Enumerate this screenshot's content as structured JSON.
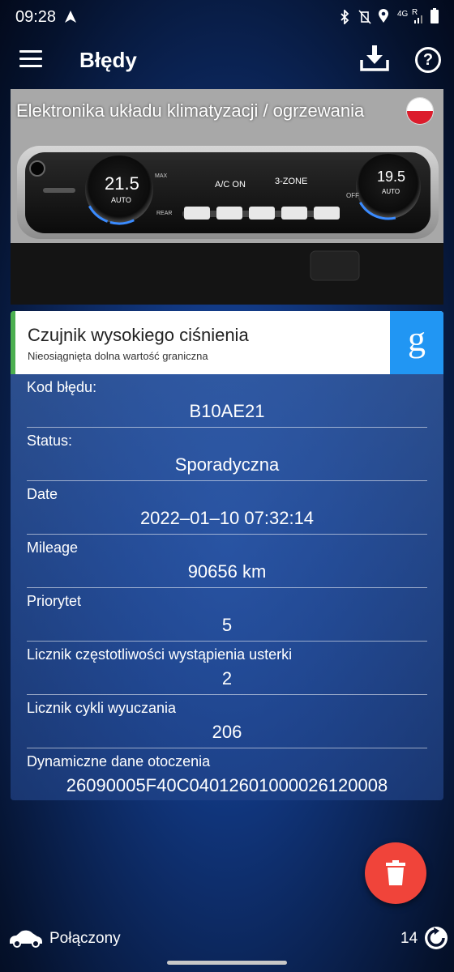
{
  "status_bar": {
    "time": "09:28",
    "network": "4G",
    "roaming": "R"
  },
  "app_bar": {
    "title": "Błędy",
    "menu_icon": "hamburger-menu-icon",
    "download_icon": "download-icon",
    "help_label": "?"
  },
  "module": {
    "title": "Elektronika układu klimatyzacji / ogrzewania",
    "language_flag": "poland-flag-icon",
    "panel": {
      "left_temp": "21.5",
      "left_mode": "AUTO",
      "right_temp": "19.5",
      "right_mode": "AUTO",
      "ac_label": "A/C ON",
      "zone_label": "3-ZONE",
      "max_label": "MAX",
      "rear_label": "REAR",
      "off_label": "OFF"
    }
  },
  "fault": {
    "name": "Czujnik wysokiego ciśnienia",
    "description": "Nieosiągnięta dolna wartość graniczna",
    "search_label": "g",
    "rows": [
      {
        "label": "Kod błędu:",
        "value": "B10AE21"
      },
      {
        "label": "Status:",
        "value": "Sporadyczna"
      },
      {
        "label": "Date",
        "value": "2022–01–10 07:32:14"
      },
      {
        "label": "Mileage",
        "value": "90656 km"
      },
      {
        "label": "Priorytet",
        "value": "5"
      },
      {
        "label": "Licznik częstotliwości wystąpienia usterki",
        "value": "2"
      },
      {
        "label": "Licznik cykli wyuczania",
        "value": "206"
      },
      {
        "label": "Dynamiczne dane otoczenia",
        "value": "26090005F40C040126010000261200​08"
      }
    ]
  },
  "bottom_bar": {
    "connection_status": "Połączony",
    "count": "14"
  },
  "colors": {
    "fab": "#f0443a",
    "google_button": "#2196f3",
    "fault_accent": "#4caf50"
  }
}
